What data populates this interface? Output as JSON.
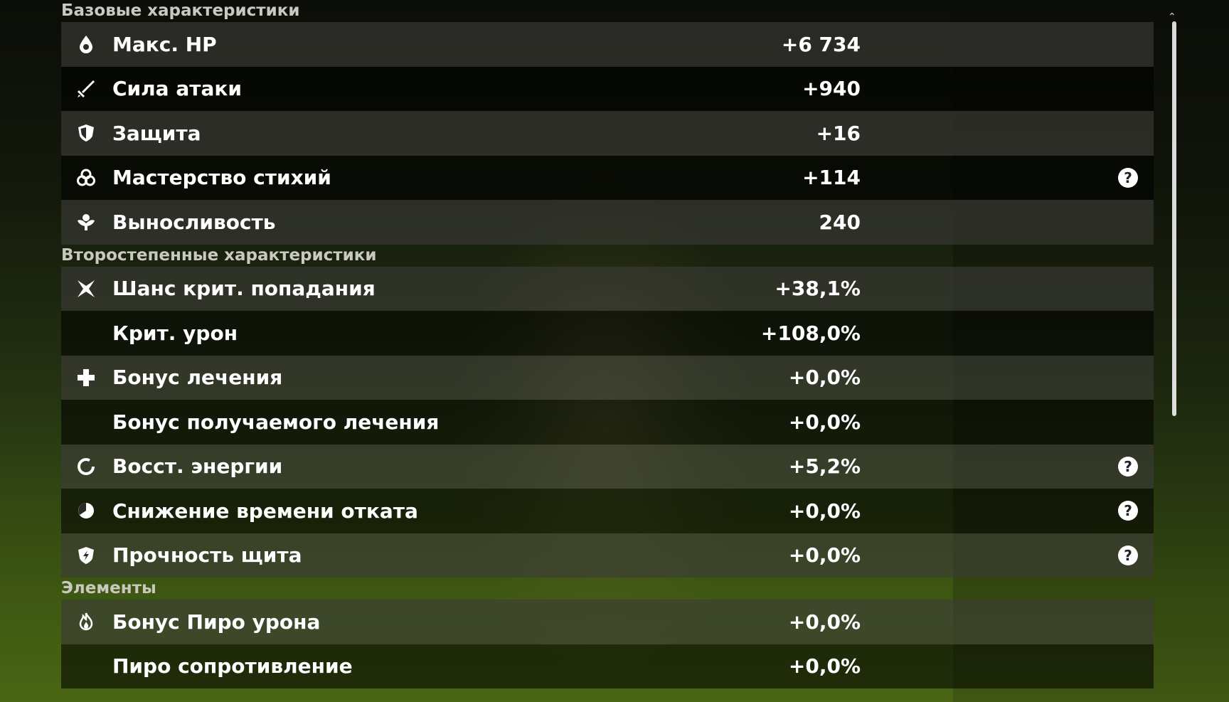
{
  "sections": [
    {
      "title": "Базовые характеристики",
      "rows": [
        {
          "icon": "droplet-icon",
          "label": "Макс. HP",
          "value": "+6 734",
          "help": false
        },
        {
          "icon": "sword-icon",
          "label": "Сила атаки",
          "value": "+940",
          "help": false
        },
        {
          "icon": "shield-icon",
          "label": "Защита",
          "value": "+16",
          "help": false
        },
        {
          "icon": "elemental-mastery-icon",
          "label": "Мастерство стихий",
          "value": "+114",
          "help": true
        },
        {
          "icon": "stamina-icon",
          "label": "Выносливость",
          "value": "240",
          "help": false
        }
      ]
    },
    {
      "title": "Второстепенные характеристики",
      "rows": [
        {
          "icon": "crit-icon",
          "label": "Шанс крит. попадания",
          "value": "+38,1%",
          "help": false
        },
        {
          "icon": "",
          "label": "Крит. урон",
          "value": "+108,0%",
          "help": false
        },
        {
          "icon": "plus-cross-icon",
          "label": "Бонус лечения",
          "value": "+0,0%",
          "help": false
        },
        {
          "icon": "",
          "label": "Бонус получаемого лечения",
          "value": "+0,0%",
          "help": false
        },
        {
          "icon": "energy-recharge-icon",
          "label": "Восст. энергии",
          "value": "+5,2%",
          "help": true
        },
        {
          "icon": "cooldown-icon",
          "label": "Снижение времени отката",
          "value": "+0,0%",
          "help": true
        },
        {
          "icon": "shield-strength-icon",
          "label": "Прочность щита",
          "value": "+0,0%",
          "help": true
        }
      ]
    },
    {
      "title": "Элементы",
      "rows": [
        {
          "icon": "pyro-icon",
          "label": "Бонус Пиро урона",
          "value": "+0,0%",
          "help": false
        },
        {
          "icon": "",
          "label": "Пиро сопротивление",
          "value": "+0,0%",
          "help": false
        }
      ]
    }
  ],
  "help_glyph": "?",
  "scroll_up_glyph": "⌃"
}
